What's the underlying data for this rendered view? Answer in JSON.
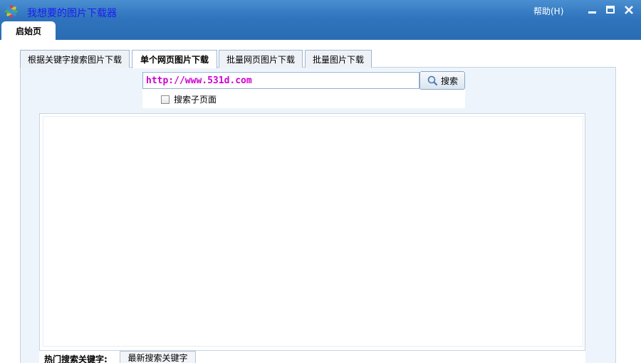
{
  "window": {
    "title": "我想要的图片下载器",
    "help_menu": "帮助(H)",
    "start_tab": "启始页"
  },
  "tabs": [
    {
      "label": "根据关键字搜索图片下载",
      "active": false
    },
    {
      "label": "单个网页图片下载",
      "active": true
    },
    {
      "label": "批量网页图片下载",
      "active": false
    },
    {
      "label": "批量图片下载",
      "active": false
    }
  ],
  "search": {
    "url_value": "http://www.531d.com",
    "button_label": "搜索",
    "subpage_checkbox_label": "搜索子页面",
    "subpage_checked": false
  },
  "keywords": {
    "hot_label": "热门搜索关键字:",
    "latest_tab": "最新搜索关键字"
  },
  "colors": {
    "titlebar": "#2f74bd",
    "title_text": "#1c1cf0",
    "url_text": "#d000d0"
  }
}
